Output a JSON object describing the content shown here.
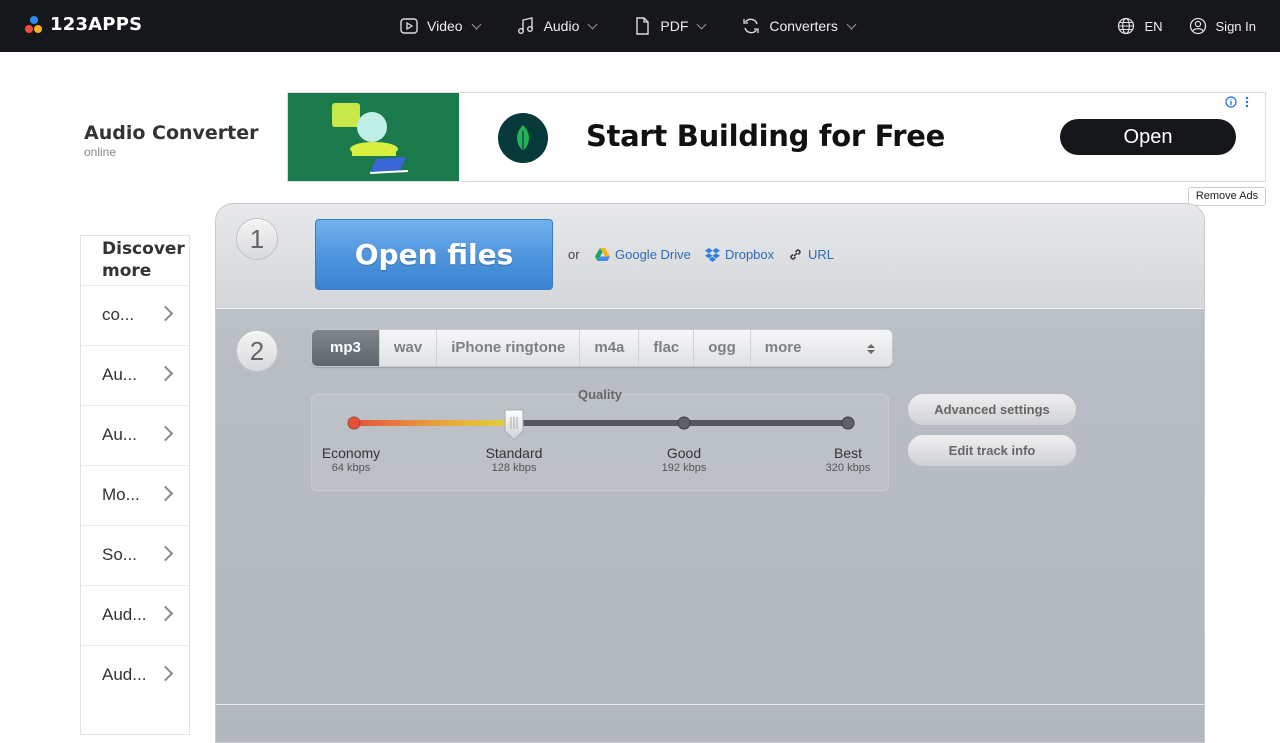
{
  "nav": {
    "brand": "123APPS",
    "items": [
      {
        "label": "Video",
        "icon": "video-icon"
      },
      {
        "label": "Audio",
        "icon": "music-note-icon"
      },
      {
        "label": "PDF",
        "icon": "document-icon"
      },
      {
        "label": "Converters",
        "icon": "refresh-icon"
      }
    ],
    "language": "EN",
    "sign_in": "Sign In"
  },
  "app": {
    "title": "Audio Converter",
    "subtitle": "online"
  },
  "ad": {
    "headline": "Start Building for Free",
    "cta": "Open",
    "remove_ads": "Remove Ads"
  },
  "sidebar": {
    "heading": "Discover more",
    "items": [
      "co...",
      "Au...",
      "Au...",
      "Mo...",
      "So...",
      "Aud...",
      "Aud..."
    ]
  },
  "step1": {
    "number": "1",
    "open_files": "Open files",
    "or": "or",
    "sources": [
      "Google Drive",
      "Dropbox",
      "URL"
    ]
  },
  "step2": {
    "number": "2",
    "formats": [
      "mp3",
      "wav",
      "iPhone ringtone",
      "m4a",
      "flac",
      "ogg",
      "more"
    ],
    "selected_format": "mp3",
    "quality": {
      "title": "Quality",
      "levels": [
        {
          "label": "Economy",
          "bitrate": "64 kbps"
        },
        {
          "label": "Standard",
          "bitrate": "128 kbps"
        },
        {
          "label": "Good",
          "bitrate": "192 kbps"
        },
        {
          "label": "Best",
          "bitrate": "320 kbps"
        }
      ],
      "selected_index": 1
    },
    "advanced_settings": "Advanced settings",
    "edit_track_info": "Edit track info"
  },
  "colors": {
    "topbar": "#16171b",
    "accent_blue": "#4d93dd",
    "link": "#2f6bb8"
  }
}
